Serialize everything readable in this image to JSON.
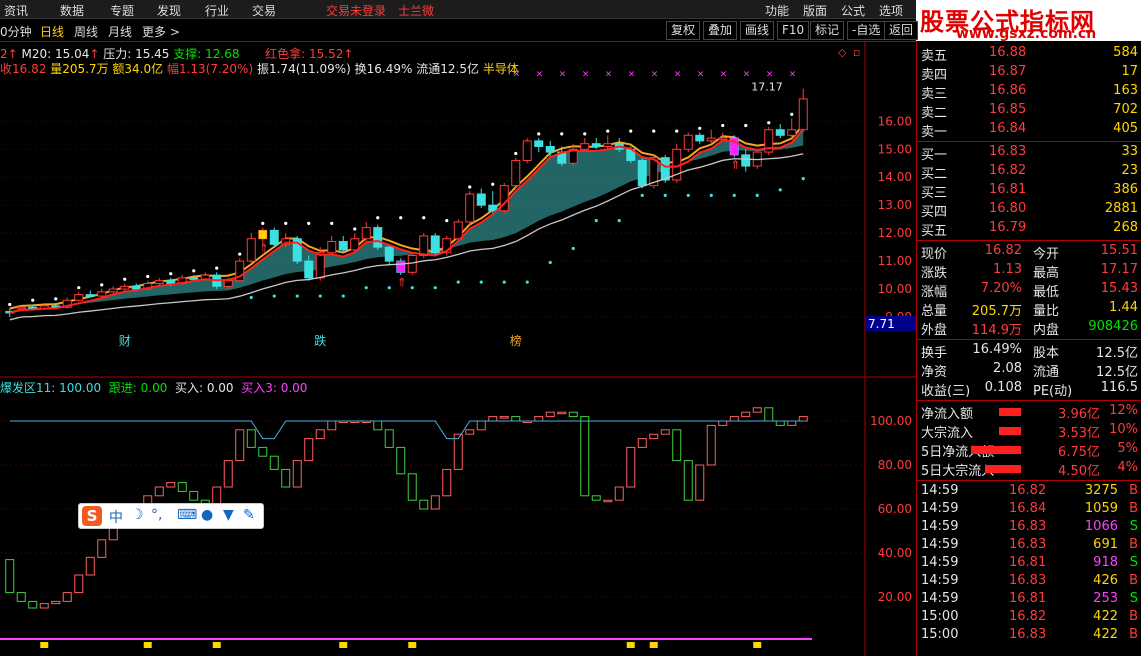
{
  "menu": {
    "items": [
      "资讯",
      "数据",
      "专题",
      "发现",
      "行业",
      "交易"
    ],
    "center": [
      "交易未登录",
      "士兰微"
    ],
    "right": [
      "功能",
      "版面",
      "公式",
      "选项"
    ]
  },
  "period_tabs": [
    "0分钟",
    "日线",
    "周线",
    "月线",
    "更多 >"
  ],
  "toolbar_buttons": [
    "复权",
    "叠加",
    "画线",
    "F10",
    "标记",
    "-自选",
    "返回"
  ],
  "logo": {
    "title": "股票公式指标网",
    "url": "www.gsxz.com.cn"
  },
  "ma_line": {
    "p1": "2",
    "m20": "M20: 15.04",
    "pressure": "压力: 15.45",
    "support": "支撑: 12.68",
    "redcolor": "红色拿: 15.52"
  },
  "stat_line": {
    "close": "收16.82",
    "vol": "量205.7万",
    "amount": "额34.0亿",
    "change": "幅1.13(7.20%)",
    "amplitude": "振1.74(11.09%)",
    "turnover": "换16.49%",
    "float": "流通12.5亿",
    "sector": "半导体"
  },
  "sub_indicator": {
    "name": "爆发区11: 100.00",
    "follow": "跟进: 0.00",
    "buy": "买入: 0.00",
    "buy3": "买入3: 0.00"
  },
  "price_axis": [
    "16.00",
    "15.00",
    "14.00",
    "13.00",
    "12.00",
    "11.00",
    "10.00",
    "9.00"
  ],
  "price_tag": "7.71",
  "osc_axis": [
    "100.00",
    "80.00",
    "60.00",
    "40.00",
    "20.00"
  ],
  "peak_label": "17.17",
  "event_tags": [
    "财",
    "跌",
    "榜"
  ],
  "order_book": {
    "asks": [
      {
        "label": "卖五",
        "price": "16.88",
        "vol": "584"
      },
      {
        "label": "卖四",
        "price": "16.87",
        "vol": "17"
      },
      {
        "label": "卖三",
        "price": "16.86",
        "vol": "163"
      },
      {
        "label": "卖二",
        "price": "16.85",
        "vol": "702"
      },
      {
        "label": "卖一",
        "price": "16.84",
        "vol": "405"
      }
    ],
    "bids": [
      {
        "label": "买一",
        "price": "16.83",
        "vol": "33"
      },
      {
        "label": "买二",
        "price": "16.82",
        "vol": "23"
      },
      {
        "label": "买三",
        "price": "16.81",
        "vol": "386"
      },
      {
        "label": "买四",
        "price": "16.80",
        "vol": "2881"
      },
      {
        "label": "买五",
        "price": "16.79",
        "vol": "268"
      }
    ]
  },
  "quote": {
    "now_l": "现价",
    "now": "16.82",
    "open_l": "今开",
    "open": "15.51",
    "chg_l": "涨跌",
    "chg": "1.13",
    "high_l": "最高",
    "high": "17.17",
    "pct_l": "涨幅",
    "pct": "7.20%",
    "low_l": "最低",
    "low": "15.43",
    "vol_l": "总量",
    "vol": "205.7万",
    "vr_l": "量比",
    "vr": "1.44",
    "out_l": "外盘",
    "out": "114.9万",
    "in_l": "内盘",
    "in": "908426",
    "to_l": "换手",
    "to": "16.49%",
    "cap_l": "股本",
    "cap": "12.5亿",
    "na_l": "净资",
    "na": "2.08",
    "fl_l": "流通",
    "fl": "12.5亿",
    "eps_l": "收益(三)",
    "eps": "0.108",
    "pe_l": "PE(动)",
    "pe": "116.5"
  },
  "flows": [
    {
      "label": "净流入额",
      "value": "3.96亿",
      "pct": "12%"
    },
    {
      "label": "大宗流入",
      "value": "3.53亿",
      "pct": "10%"
    },
    {
      "label": "5日净流入额",
      "value": "6.75亿",
      "pct": "5%"
    },
    {
      "label": "5日大宗流入",
      "value": "4.50亿",
      "pct": "4%"
    }
  ],
  "ticks": [
    {
      "t": "14:59",
      "p": "16.82",
      "v": "3275",
      "d": "B"
    },
    {
      "t": "14:59",
      "p": "16.84",
      "v": "1059",
      "d": "B"
    },
    {
      "t": "14:59",
      "p": "16.83",
      "v": "1066",
      "d": "S"
    },
    {
      "t": "14:59",
      "p": "16.83",
      "v": "691",
      "d": "B"
    },
    {
      "t": "14:59",
      "p": "16.81",
      "v": "918",
      "d": "S"
    },
    {
      "t": "14:59",
      "p": "16.83",
      "v": "426",
      "d": "B"
    },
    {
      "t": "14:59",
      "p": "16.81",
      "v": "253",
      "d": "S"
    },
    {
      "t": "15:00",
      "p": "16.82",
      "v": "422",
      "d": "B"
    },
    {
      "t": "15:00",
      "p": "16.83",
      "v": "422",
      "d": "B"
    }
  ],
  "ime": {
    "s": "S",
    "mode": "中"
  },
  "colors": {
    "up": "#ff3b3b",
    "down": "#3de0e0",
    "bg": "#000000",
    "grid": "#b00000"
  },
  "chart_data": {
    "type": "candlestick",
    "price_ylim": [
      8.5,
      17.8
    ],
    "candles": [
      [
        9.2,
        9.15,
        9.3,
        9.0
      ],
      [
        9.3,
        9.35,
        9.4,
        9.2
      ],
      [
        9.35,
        9.3,
        9.45,
        9.25
      ],
      [
        9.3,
        9.4,
        9.5,
        9.25
      ],
      [
        9.4,
        9.35,
        9.5,
        9.3
      ],
      [
        9.35,
        9.6,
        9.7,
        9.3
      ],
      [
        9.6,
        9.8,
        9.9,
        9.55
      ],
      [
        9.8,
        9.75,
        9.95,
        9.7
      ],
      [
        9.75,
        9.9,
        10.0,
        9.7
      ],
      [
        9.9,
        10.0,
        10.1,
        9.85
      ],
      [
        10.0,
        10.1,
        10.2,
        9.9
      ],
      [
        10.1,
        10.0,
        10.2,
        9.95
      ],
      [
        10.0,
        10.2,
        10.3,
        9.95
      ],
      [
        10.2,
        10.3,
        10.4,
        10.1
      ],
      [
        10.3,
        10.2,
        10.4,
        10.1
      ],
      [
        10.2,
        10.4,
        10.5,
        10.15
      ],
      [
        10.4,
        10.35,
        10.5,
        10.25
      ],
      [
        10.35,
        10.5,
        10.6,
        10.3
      ],
      [
        10.5,
        10.1,
        10.6,
        10.0
      ],
      [
        10.1,
        10.3,
        10.4,
        10.0
      ],
      [
        10.3,
        11.0,
        11.1,
        10.25
      ],
      [
        11.0,
        11.8,
        12.0,
        10.9
      ],
      [
        11.8,
        12.1,
        12.2,
        11.6
      ],
      [
        12.1,
        11.6,
        12.2,
        11.5
      ],
      [
        11.6,
        11.8,
        12.0,
        11.5
      ],
      [
        11.8,
        11.0,
        11.9,
        10.9
      ],
      [
        11.0,
        10.4,
        11.2,
        10.3
      ],
      [
        10.4,
        11.3,
        11.5,
        10.3
      ],
      [
        11.3,
        11.7,
        11.9,
        11.2
      ],
      [
        11.7,
        11.4,
        11.9,
        11.3
      ],
      [
        11.4,
        11.8,
        12.0,
        11.3
      ],
      [
        11.8,
        12.2,
        12.4,
        11.7
      ],
      [
        12.2,
        11.5,
        12.3,
        11.4
      ],
      [
        11.5,
        11.0,
        11.6,
        10.9
      ],
      [
        11.0,
        10.6,
        11.1,
        10.5
      ],
      [
        10.6,
        11.2,
        11.3,
        10.5
      ],
      [
        11.2,
        11.9,
        12.0,
        11.1
      ],
      [
        11.9,
        11.3,
        12.0,
        11.2
      ],
      [
        11.3,
        11.8,
        11.9,
        11.2
      ],
      [
        11.8,
        12.4,
        12.5,
        11.7
      ],
      [
        12.4,
        13.4,
        13.5,
        12.3
      ],
      [
        13.4,
        13.0,
        13.6,
        12.9
      ],
      [
        13.0,
        12.8,
        13.5,
        12.7
      ],
      [
        12.8,
        13.7,
        13.8,
        12.7
      ],
      [
        13.7,
        14.6,
        14.7,
        13.6
      ],
      [
        14.6,
        15.3,
        15.4,
        14.5
      ],
      [
        15.3,
        15.1,
        15.4,
        14.9
      ],
      [
        15.1,
        14.9,
        15.3,
        14.7
      ],
      [
        14.9,
        14.5,
        15.1,
        14.4
      ],
      [
        14.5,
        15.0,
        15.2,
        14.4
      ],
      [
        15.0,
        15.2,
        15.4,
        14.9
      ],
      [
        15.2,
        15.1,
        15.4,
        15.0
      ],
      [
        15.1,
        15.2,
        15.5,
        15.0
      ],
      [
        15.2,
        15.0,
        15.4,
        14.9
      ],
      [
        15.0,
        14.6,
        15.1,
        14.5
      ],
      [
        14.6,
        13.7,
        14.7,
        13.6
      ],
      [
        13.7,
        14.7,
        14.8,
        13.6
      ],
      [
        14.7,
        13.9,
        14.8,
        13.8
      ],
      [
        13.9,
        15.0,
        15.2,
        13.8
      ],
      [
        15.0,
        15.5,
        15.6,
        14.9
      ],
      [
        15.5,
        15.3,
        15.6,
        15.2
      ],
      [
        15.3,
        15.4,
        15.7,
        15.2
      ],
      [
        15.4,
        15.4,
        15.6,
        15.3
      ],
      [
        15.4,
        14.8,
        15.5,
        14.7
      ],
      [
        14.8,
        14.4,
        15.0,
        14.2
      ],
      [
        14.4,
        14.9,
        15.0,
        14.3
      ],
      [
        14.9,
        15.7,
        15.8,
        14.8
      ],
      [
        15.7,
        15.5,
        15.9,
        15.4
      ],
      [
        15.5,
        15.7,
        16.1,
        15.4
      ],
      [
        15.7,
        16.8,
        17.17,
        15.6
      ]
    ],
    "osc_ylim": [
      0,
      110
    ],
    "osc": [
      [
        37,
        22
      ],
      [
        22,
        18
      ],
      [
        18,
        15
      ],
      [
        15,
        17
      ],
      [
        17,
        18
      ],
      [
        18,
        22
      ],
      [
        22,
        30
      ],
      [
        30,
        38
      ],
      [
        38,
        46
      ],
      [
        46,
        52
      ],
      [
        52,
        58
      ],
      [
        58,
        62
      ],
      [
        62,
        66
      ],
      [
        66,
        70
      ],
      [
        70,
        72
      ],
      [
        72,
        68
      ],
      [
        68,
        64
      ],
      [
        64,
        60
      ],
      [
        60,
        70
      ],
      [
        70,
        82
      ],
      [
        82,
        96
      ],
      [
        96,
        88
      ],
      [
        88,
        84
      ],
      [
        84,
        78
      ],
      [
        78,
        70
      ],
      [
        70,
        82
      ],
      [
        82,
        92
      ],
      [
        92,
        96
      ],
      [
        96,
        100
      ],
      [
        100,
        100
      ],
      [
        100,
        100
      ],
      [
        100,
        100
      ],
      [
        100,
        96
      ],
      [
        96,
        88
      ],
      [
        88,
        76
      ],
      [
        76,
        64
      ],
      [
        64,
        60
      ],
      [
        60,
        66
      ],
      [
        66,
        78
      ],
      [
        78,
        94
      ],
      [
        94,
        96
      ],
      [
        96,
        100
      ],
      [
        100,
        102
      ],
      [
        102,
        102
      ],
      [
        102,
        100
      ],
      [
        100,
        100
      ],
      [
        100,
        102
      ],
      [
        102,
        104
      ],
      [
        104,
        104
      ],
      [
        104,
        102
      ],
      [
        102,
        66
      ],
      [
        66,
        64
      ],
      [
        64,
        64
      ],
      [
        64,
        70
      ],
      [
        70,
        88
      ],
      [
        88,
        92
      ],
      [
        92,
        94
      ],
      [
        94,
        96
      ],
      [
        96,
        82
      ],
      [
        82,
        64
      ],
      [
        64,
        80
      ],
      [
        80,
        98
      ],
      [
        98,
        100
      ],
      [
        100,
        102
      ],
      [
        102,
        104
      ],
      [
        104,
        106
      ],
      [
        106,
        100
      ],
      [
        100,
        98
      ],
      [
        98,
        100
      ],
      [
        100,
        102
      ]
    ]
  }
}
